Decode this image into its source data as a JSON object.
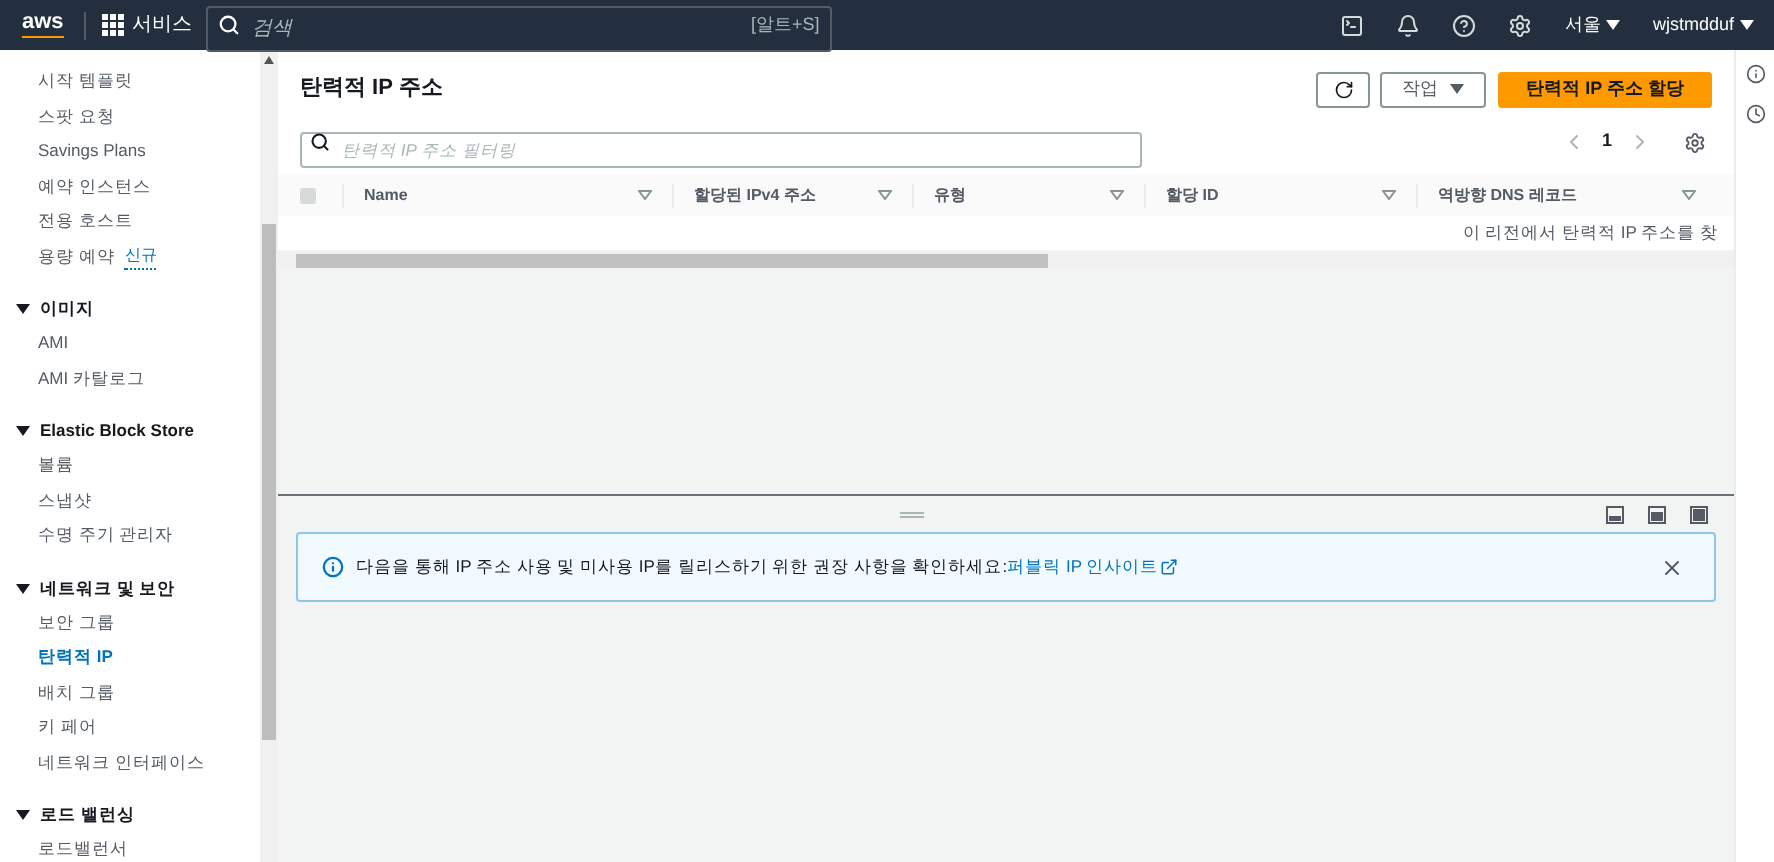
{
  "topbar": {
    "logo": "aws",
    "services": "서비스",
    "search": {
      "placeholder": "검색"
    },
    "shortcut": "[알트+S]",
    "region": "서울",
    "user": "wjstmdduf"
  },
  "sidebar": {
    "sections": [
      {
        "items": [
          {
            "label": "시작 템플릿",
            "selected": false
          },
          {
            "label": "스팟 요청",
            "selected": false
          },
          {
            "label": "Savings Plans",
            "selected": false
          },
          {
            "label": "예약 인스턴스",
            "selected": false
          },
          {
            "label": "전용 호스트",
            "selected": false
          },
          {
            "label": "용량 예약",
            "selected": false,
            "badge": "신규"
          }
        ]
      },
      {
        "title": "이미지",
        "expanded": true,
        "items": [
          {
            "label": "AMI",
            "selected": false
          },
          {
            "label": "AMI 카탈로그",
            "selected": false
          }
        ]
      },
      {
        "title": "Elastic Block Store",
        "expanded": true,
        "items": [
          {
            "label": "볼륨",
            "selected": false
          },
          {
            "label": "스냅샷",
            "selected": false
          },
          {
            "label": "수명 주기 관리자",
            "selected": false
          }
        ]
      },
      {
        "title": "네트워크 및 보안",
        "expanded": true,
        "items": [
          {
            "label": "보안 그룹",
            "selected": false
          },
          {
            "label": "탄력적 IP",
            "selected": true
          },
          {
            "label": "배치 그룹",
            "selected": false
          },
          {
            "label": "키 페어",
            "selected": false
          },
          {
            "label": "네트워크 인터페이스",
            "selected": false
          }
        ]
      },
      {
        "title": "로드 밸런싱",
        "expanded": true,
        "items": [
          {
            "label": "로드밸런서",
            "selected": false
          }
        ]
      }
    ]
  },
  "main": {
    "title": "탄력적 IP 주소",
    "actions_button": "작업",
    "primary_button": "탄력적 IP 주소 할당",
    "filter": {
      "placeholder": "탄력적 IP 주소 필터링"
    },
    "page": "1",
    "table": {
      "select_all": {
        "checked": false
      },
      "columns": [
        "Name",
        "할당된 IPv4 주소",
        "유형",
        "할당 ID",
        "역방향 DNS 레코드"
      ],
      "empty_message": "이 리전에서 탄력적 IP 주소를 찾"
    }
  },
  "alert": {
    "text": "다음을 통해 IP 주소 사용 및 미사용 IP를 릴리스하기 위한 권장 사항을 확인하세요: ",
    "link": "퍼블릭 IP 인사이트"
  }
}
